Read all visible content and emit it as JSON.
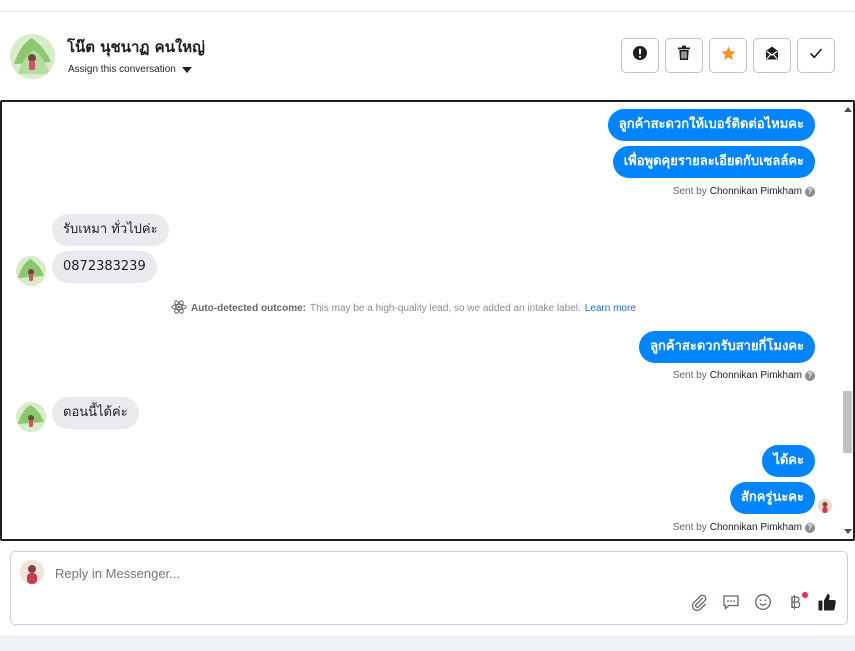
{
  "header": {
    "contact_name": "โน๊ต นุชนาฏ คนใหญ่",
    "assign_label": "Assign this conversation",
    "actions": [
      {
        "name": "mark-spam-button",
        "icon": "exclamation-icon"
      },
      {
        "name": "delete-button",
        "icon": "trash-icon"
      },
      {
        "name": "star-button",
        "icon": "star-icon"
      },
      {
        "name": "mark-unread-button",
        "icon": "envelope-icon"
      },
      {
        "name": "mark-done-button",
        "icon": "check-icon"
      }
    ]
  },
  "thread": {
    "messages": [
      {
        "dir": "out",
        "text": "ลูกค้าสะดวกให้เบอร์ติดต่อไหมคะ"
      },
      {
        "dir": "out",
        "text": "เพื่อพูดคุยรายละเอียดกับเซลล์คะ"
      },
      {
        "dir": "in",
        "text": "รับเหมา ทั่วไปค่ะ"
      },
      {
        "dir": "in",
        "text": "0872383239"
      },
      {
        "dir": "out",
        "text": "ลูกค้าสะดวกรับสายกี่โมงคะ"
      },
      {
        "dir": "in",
        "text": "ตอนนี้ได้ค่ะ"
      },
      {
        "dir": "out",
        "text": "ได้คะ"
      },
      {
        "dir": "out",
        "text": "สักครู่นะคะ"
      }
    ],
    "sent_by_prefix": "Sent by",
    "sender": "Chonnikan Pimkham",
    "notice": {
      "label": "Auto-detected outcome:",
      "text": "This may be a high-quality lead, so we added an intake label.",
      "link": "Learn more"
    }
  },
  "composer": {
    "placeholder": "Reply in Messenger...",
    "tools": [
      "paperclip-icon",
      "saved-reply-icon",
      "emoji-icon",
      "baht-payment-icon",
      "thumbs-up-icon"
    ]
  },
  "colors": {
    "outgoing_bubble": "#0084ff",
    "incoming_bubble": "#e9eaed",
    "star": "#f0932b",
    "link": "#216fdb"
  }
}
